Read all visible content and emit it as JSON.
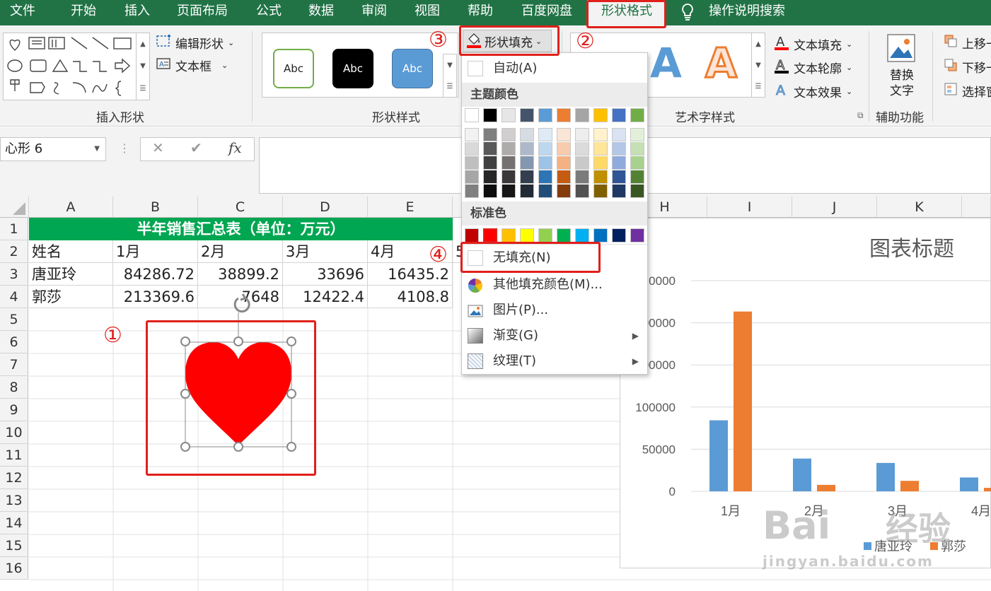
{
  "tabs": [
    "文件",
    "开始",
    "插入",
    "页面布局",
    "公式",
    "数据",
    "审阅",
    "视图",
    "帮助",
    "百度网盘",
    "形状格式",
    "操作说明搜索"
  ],
  "ribbon": {
    "insert_shapes": {
      "label": "插入形状",
      "edit_shape": "编辑形状",
      "text_box": "文本框"
    },
    "shape_styles": {
      "label": "形状样式",
      "abc": [
        "Abc",
        "Abc",
        "Abc"
      ],
      "shape_fill": "形状填充"
    },
    "wordart": {
      "label": "艺术字样式",
      "text_fill": "文本填充",
      "text_outline": "文本轮廓",
      "text_effects": "文本效果",
      "sample": "A"
    },
    "accessibility": {
      "label": "辅助功能",
      "alt_text": "替换文字"
    },
    "arrange": {
      "move_up": "上移一",
      "move_down": "下移一",
      "selection": "选择窗"
    }
  },
  "formula_bar": {
    "name_box": "心形 6",
    "cancel": "✕",
    "enter": "✔",
    "fx": "fx"
  },
  "sheet": {
    "columns": [
      "A",
      "B",
      "C",
      "D",
      "E",
      "H",
      "I",
      "J",
      "K"
    ],
    "rows": [
      "1",
      "2",
      "3",
      "4",
      "5",
      "6",
      "7",
      "8",
      "9",
      "10",
      "11",
      "12",
      "13",
      "14",
      "15",
      "16"
    ],
    "title": "半年销售汇总表（单位：万元）",
    "header": [
      "姓名",
      "1月",
      "2月",
      "3月",
      "4月"
    ],
    "data": [
      [
        "唐亚玲",
        "84286.72",
        "38899.2",
        "33696",
        "16435.2"
      ],
      [
        "郭莎",
        "213369.6",
        "7648",
        "12422.4",
        "4108.8"
      ]
    ],
    "col_f_partial": "5"
  },
  "dropdown": {
    "auto": "自动(A)",
    "theme_colors": "主题颜色",
    "standard_colors": "标准色",
    "no_fill": "无填充(N)",
    "more_colors": "其他填充颜色(M)...",
    "picture": "图片(P)...",
    "gradient": "渐变(G)",
    "texture": "纹理(T)",
    "theme_top": [
      "#ffffff",
      "#000000",
      "#e7e6e6",
      "#44546a",
      "#5b9bd5",
      "#ed7d31",
      "#a5a5a5",
      "#ffc000",
      "#4472c4",
      "#70ad47"
    ],
    "theme_shades": [
      [
        "#f2f2f2",
        "#d9d9d9",
        "#bfbfbf",
        "#a6a6a6",
        "#808080"
      ],
      [
        "#7f7f7f",
        "#595959",
        "#404040",
        "#262626",
        "#0d0d0d"
      ],
      [
        "#d0cece",
        "#aeabab",
        "#757171",
        "#3a3838",
        "#171616"
      ],
      [
        "#d6dce4",
        "#adb9ca",
        "#8497b0",
        "#333f4f",
        "#222a35"
      ],
      [
        "#deebf7",
        "#bdd7ee",
        "#9dc3e6",
        "#2e75b6",
        "#1f4e79"
      ],
      [
        "#fbe5d6",
        "#f8cbad",
        "#f4b183",
        "#c55a11",
        "#843c0c"
      ],
      [
        "#ededed",
        "#dbdbdb",
        "#c9c9c9",
        "#7b7b7b",
        "#525252"
      ],
      [
        "#fff2cc",
        "#ffe699",
        "#ffd966",
        "#bf9000",
        "#7f6000"
      ],
      [
        "#dae3f3",
        "#b4c7e7",
        "#8faadc",
        "#2f5597",
        "#203864"
      ],
      [
        "#e2f0d9",
        "#c5e0b4",
        "#a9d18e",
        "#548235",
        "#385723"
      ]
    ],
    "standard": [
      "#c00000",
      "#ff0000",
      "#ffc000",
      "#ffff00",
      "#92d050",
      "#00b050",
      "#00b0f0",
      "#0070c0",
      "#002060",
      "#7030a0"
    ]
  },
  "callouts": [
    "①",
    "②",
    "③",
    "④"
  ],
  "heart_color": "#ff0000",
  "chart_data": {
    "type": "bar",
    "title": "图表标题",
    "categories": [
      "1月",
      "2月",
      "3月",
      "4月"
    ],
    "yticks": [
      "0",
      "50000",
      "100000",
      "00000",
      "00000",
      "0000"
    ],
    "ylim": [
      0,
      250000
    ],
    "series": [
      {
        "name": "唐亚玲",
        "color": "#5b9bd5",
        "values": [
          84286.72,
          38899.2,
          33696,
          16435.2
        ]
      },
      {
        "name": "郭莎",
        "color": "#ed7d31",
        "values": [
          213369.6,
          7648,
          12422.4,
          4108.8
        ]
      }
    ],
    "legend": "bottom"
  },
  "watermark": {
    "brand": "Bai",
    "brand2": "经验",
    "url": "jingyan.baidu.com"
  }
}
